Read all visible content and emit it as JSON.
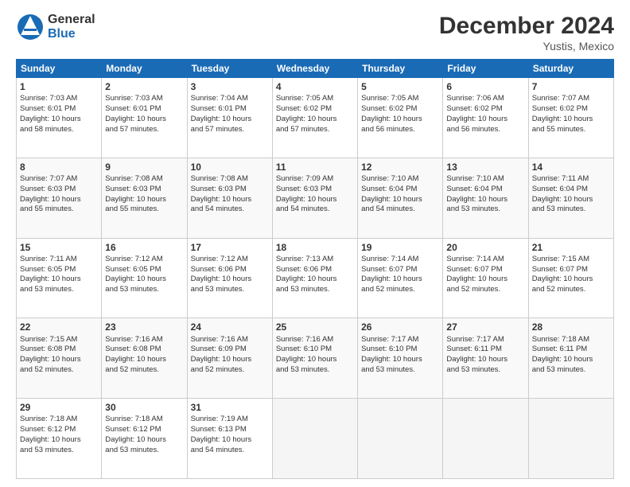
{
  "logo": {
    "general": "General",
    "blue": "Blue"
  },
  "title": "December 2024",
  "location": "Yustis, Mexico",
  "days_of_week": [
    "Sunday",
    "Monday",
    "Tuesday",
    "Wednesday",
    "Thursday",
    "Friday",
    "Saturday"
  ],
  "weeks": [
    [
      {
        "day": "1",
        "lines": [
          "Sunrise: 7:03 AM",
          "Sunset: 6:01 PM",
          "Daylight: 10 hours",
          "and 58 minutes."
        ]
      },
      {
        "day": "2",
        "lines": [
          "Sunrise: 7:03 AM",
          "Sunset: 6:01 PM",
          "Daylight: 10 hours",
          "and 57 minutes."
        ]
      },
      {
        "day": "3",
        "lines": [
          "Sunrise: 7:04 AM",
          "Sunset: 6:01 PM",
          "Daylight: 10 hours",
          "and 57 minutes."
        ]
      },
      {
        "day": "4",
        "lines": [
          "Sunrise: 7:05 AM",
          "Sunset: 6:02 PM",
          "Daylight: 10 hours",
          "and 57 minutes."
        ]
      },
      {
        "day": "5",
        "lines": [
          "Sunrise: 7:05 AM",
          "Sunset: 6:02 PM",
          "Daylight: 10 hours",
          "and 56 minutes."
        ]
      },
      {
        "day": "6",
        "lines": [
          "Sunrise: 7:06 AM",
          "Sunset: 6:02 PM",
          "Daylight: 10 hours",
          "and 56 minutes."
        ]
      },
      {
        "day": "7",
        "lines": [
          "Sunrise: 7:07 AM",
          "Sunset: 6:02 PM",
          "Daylight: 10 hours",
          "and 55 minutes."
        ]
      }
    ],
    [
      {
        "day": "8",
        "lines": [
          "Sunrise: 7:07 AM",
          "Sunset: 6:03 PM",
          "Daylight: 10 hours",
          "and 55 minutes."
        ]
      },
      {
        "day": "9",
        "lines": [
          "Sunrise: 7:08 AM",
          "Sunset: 6:03 PM",
          "Daylight: 10 hours",
          "and 55 minutes."
        ]
      },
      {
        "day": "10",
        "lines": [
          "Sunrise: 7:08 AM",
          "Sunset: 6:03 PM",
          "Daylight: 10 hours",
          "and 54 minutes."
        ]
      },
      {
        "day": "11",
        "lines": [
          "Sunrise: 7:09 AM",
          "Sunset: 6:03 PM",
          "Daylight: 10 hours",
          "and 54 minutes."
        ]
      },
      {
        "day": "12",
        "lines": [
          "Sunrise: 7:10 AM",
          "Sunset: 6:04 PM",
          "Daylight: 10 hours",
          "and 54 minutes."
        ]
      },
      {
        "day": "13",
        "lines": [
          "Sunrise: 7:10 AM",
          "Sunset: 6:04 PM",
          "Daylight: 10 hours",
          "and 53 minutes."
        ]
      },
      {
        "day": "14",
        "lines": [
          "Sunrise: 7:11 AM",
          "Sunset: 6:04 PM",
          "Daylight: 10 hours",
          "and 53 minutes."
        ]
      }
    ],
    [
      {
        "day": "15",
        "lines": [
          "Sunrise: 7:11 AM",
          "Sunset: 6:05 PM",
          "Daylight: 10 hours",
          "and 53 minutes."
        ]
      },
      {
        "day": "16",
        "lines": [
          "Sunrise: 7:12 AM",
          "Sunset: 6:05 PM",
          "Daylight: 10 hours",
          "and 53 minutes."
        ]
      },
      {
        "day": "17",
        "lines": [
          "Sunrise: 7:12 AM",
          "Sunset: 6:06 PM",
          "Daylight: 10 hours",
          "and 53 minutes."
        ]
      },
      {
        "day": "18",
        "lines": [
          "Sunrise: 7:13 AM",
          "Sunset: 6:06 PM",
          "Daylight: 10 hours",
          "and 53 minutes."
        ]
      },
      {
        "day": "19",
        "lines": [
          "Sunrise: 7:14 AM",
          "Sunset: 6:07 PM",
          "Daylight: 10 hours",
          "and 52 minutes."
        ]
      },
      {
        "day": "20",
        "lines": [
          "Sunrise: 7:14 AM",
          "Sunset: 6:07 PM",
          "Daylight: 10 hours",
          "and 52 minutes."
        ]
      },
      {
        "day": "21",
        "lines": [
          "Sunrise: 7:15 AM",
          "Sunset: 6:07 PM",
          "Daylight: 10 hours",
          "and 52 minutes."
        ]
      }
    ],
    [
      {
        "day": "22",
        "lines": [
          "Sunrise: 7:15 AM",
          "Sunset: 6:08 PM",
          "Daylight: 10 hours",
          "and 52 minutes."
        ]
      },
      {
        "day": "23",
        "lines": [
          "Sunrise: 7:16 AM",
          "Sunset: 6:08 PM",
          "Daylight: 10 hours",
          "and 52 minutes."
        ]
      },
      {
        "day": "24",
        "lines": [
          "Sunrise: 7:16 AM",
          "Sunset: 6:09 PM",
          "Daylight: 10 hours",
          "and 52 minutes."
        ]
      },
      {
        "day": "25",
        "lines": [
          "Sunrise: 7:16 AM",
          "Sunset: 6:10 PM",
          "Daylight: 10 hours",
          "and 53 minutes."
        ]
      },
      {
        "day": "26",
        "lines": [
          "Sunrise: 7:17 AM",
          "Sunset: 6:10 PM",
          "Daylight: 10 hours",
          "and 53 minutes."
        ]
      },
      {
        "day": "27",
        "lines": [
          "Sunrise: 7:17 AM",
          "Sunset: 6:11 PM",
          "Daylight: 10 hours",
          "and 53 minutes."
        ]
      },
      {
        "day": "28",
        "lines": [
          "Sunrise: 7:18 AM",
          "Sunset: 6:11 PM",
          "Daylight: 10 hours",
          "and 53 minutes."
        ]
      }
    ],
    [
      {
        "day": "29",
        "lines": [
          "Sunrise: 7:18 AM",
          "Sunset: 6:12 PM",
          "Daylight: 10 hours",
          "and 53 minutes."
        ]
      },
      {
        "day": "30",
        "lines": [
          "Sunrise: 7:18 AM",
          "Sunset: 6:12 PM",
          "Daylight: 10 hours",
          "and 53 minutes."
        ]
      },
      {
        "day": "31",
        "lines": [
          "Sunrise: 7:19 AM",
          "Sunset: 6:13 PM",
          "Daylight: 10 hours",
          "and 54 minutes."
        ]
      },
      null,
      null,
      null,
      null
    ]
  ]
}
